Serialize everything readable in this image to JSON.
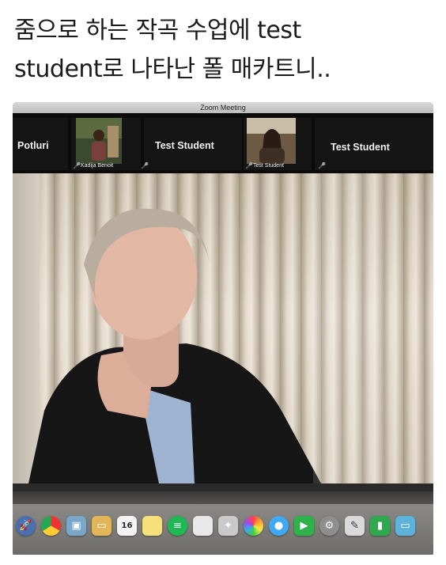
{
  "caption": {
    "line1": "줌으로 하는 작곡 수업에 test",
    "line2": "student로 나타난 폴 매카트니.."
  },
  "window": {
    "title": "Zoom Meeting"
  },
  "participants": [
    {
      "name": "Potluri"
    },
    {
      "name": "Kadija Benoit"
    },
    {
      "name": "Test Student"
    },
    {
      "name": "Test Student"
    },
    {
      "name": "Test Student"
    }
  ],
  "dock": {
    "calendar_day": "16",
    "icons": [
      "launchpad-icon",
      "chrome-icon",
      "preview-icon",
      "folder-icon",
      "calendar-icon",
      "notes-icon",
      "spotify-icon",
      "document-icon",
      "keyboard-maestro-icon",
      "photos-icon",
      "messages-icon",
      "facetime-icon",
      "system-preferences-icon",
      "script-editor-icon",
      "numbers-icon",
      "screen-icon"
    ]
  }
}
